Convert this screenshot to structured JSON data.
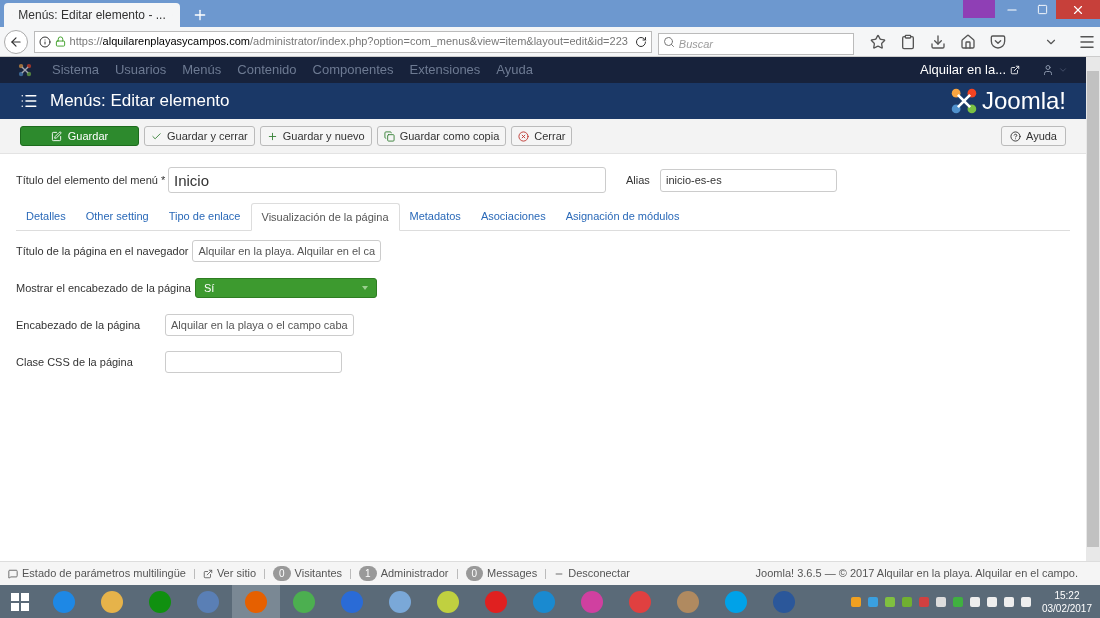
{
  "browser": {
    "tab_title": "Menús: Editar elemento - ...",
    "url_scheme": "https://",
    "url_host": "alquilarenplayasycampos.com",
    "url_path": "/administrator/index.php?option=com_menus&view=item&layout=edit&id=223",
    "search_placeholder": "Buscar"
  },
  "nav": {
    "items": [
      "Sistema",
      "Usuarios",
      "Menús",
      "Contenido",
      "Componentes",
      "Extensiones",
      "Ayuda"
    ],
    "site_link": "Alquilar en la..."
  },
  "header": {
    "title": "Menús: Editar elemento",
    "logo_text": "Joomla!"
  },
  "toolbar": [
    {
      "kind": "primary",
      "label": "Guardar"
    },
    {
      "kind": "default",
      "label": "Guardar y cerrar"
    },
    {
      "kind": "default",
      "label": "Guardar y nuevo"
    },
    {
      "kind": "default",
      "label": "Guardar como copia"
    },
    {
      "kind": "default",
      "label": "Cerrar"
    }
  ],
  "help_button": "Ayuda",
  "title_field": {
    "label": "Título del elemento del menú *",
    "value": "Inicio"
  },
  "alias_field": {
    "label": "Alias",
    "value": "inicio-es-es"
  },
  "tabs": [
    {
      "label": "Detalles",
      "selected": false
    },
    {
      "label": "Other setting",
      "selected": false
    },
    {
      "label": "Tipo de enlace",
      "selected": false
    },
    {
      "label": "Visualización de la página",
      "selected": true
    },
    {
      "label": "Metadatos",
      "selected": false
    },
    {
      "label": "Asociaciones",
      "selected": false
    },
    {
      "label": "Asignación de módulos",
      "selected": false
    }
  ],
  "page_fields": [
    {
      "kind": "text",
      "label": "Título de la página en el navegador",
      "value": "Alquilar en la playa. Alquilar en el ca"
    },
    {
      "kind": "select",
      "label": "Mostrar el encabezado de la página",
      "value": "Sí"
    },
    {
      "kind": "text",
      "label": "Encabezado de la página",
      "value": "Alquilar en la playa o el campo caba"
    },
    {
      "kind": "text",
      "label": "Clase CSS de la página"
    }
  ],
  "status_bar": {
    "items": [
      {
        "kind": "link",
        "label": "Estado de parámetros multilingüe"
      },
      {
        "kind": "link",
        "label": "Ver sitio"
      },
      {
        "kind": "count",
        "count": "0",
        "label": "Visitantes"
      },
      {
        "kind": "count",
        "count": "1",
        "label": "Administrador"
      },
      {
        "kind": "count",
        "count": "0",
        "label": "Messages"
      },
      {
        "kind": "link",
        "label": "Desconectar"
      }
    ],
    "footer": "Joomla! 3.6.5 — © 2017 Alquilar en la playa. Alquilar en el campo."
  },
  "taskbar": {
    "time": "15:22",
    "date": "03/02/2017"
  }
}
